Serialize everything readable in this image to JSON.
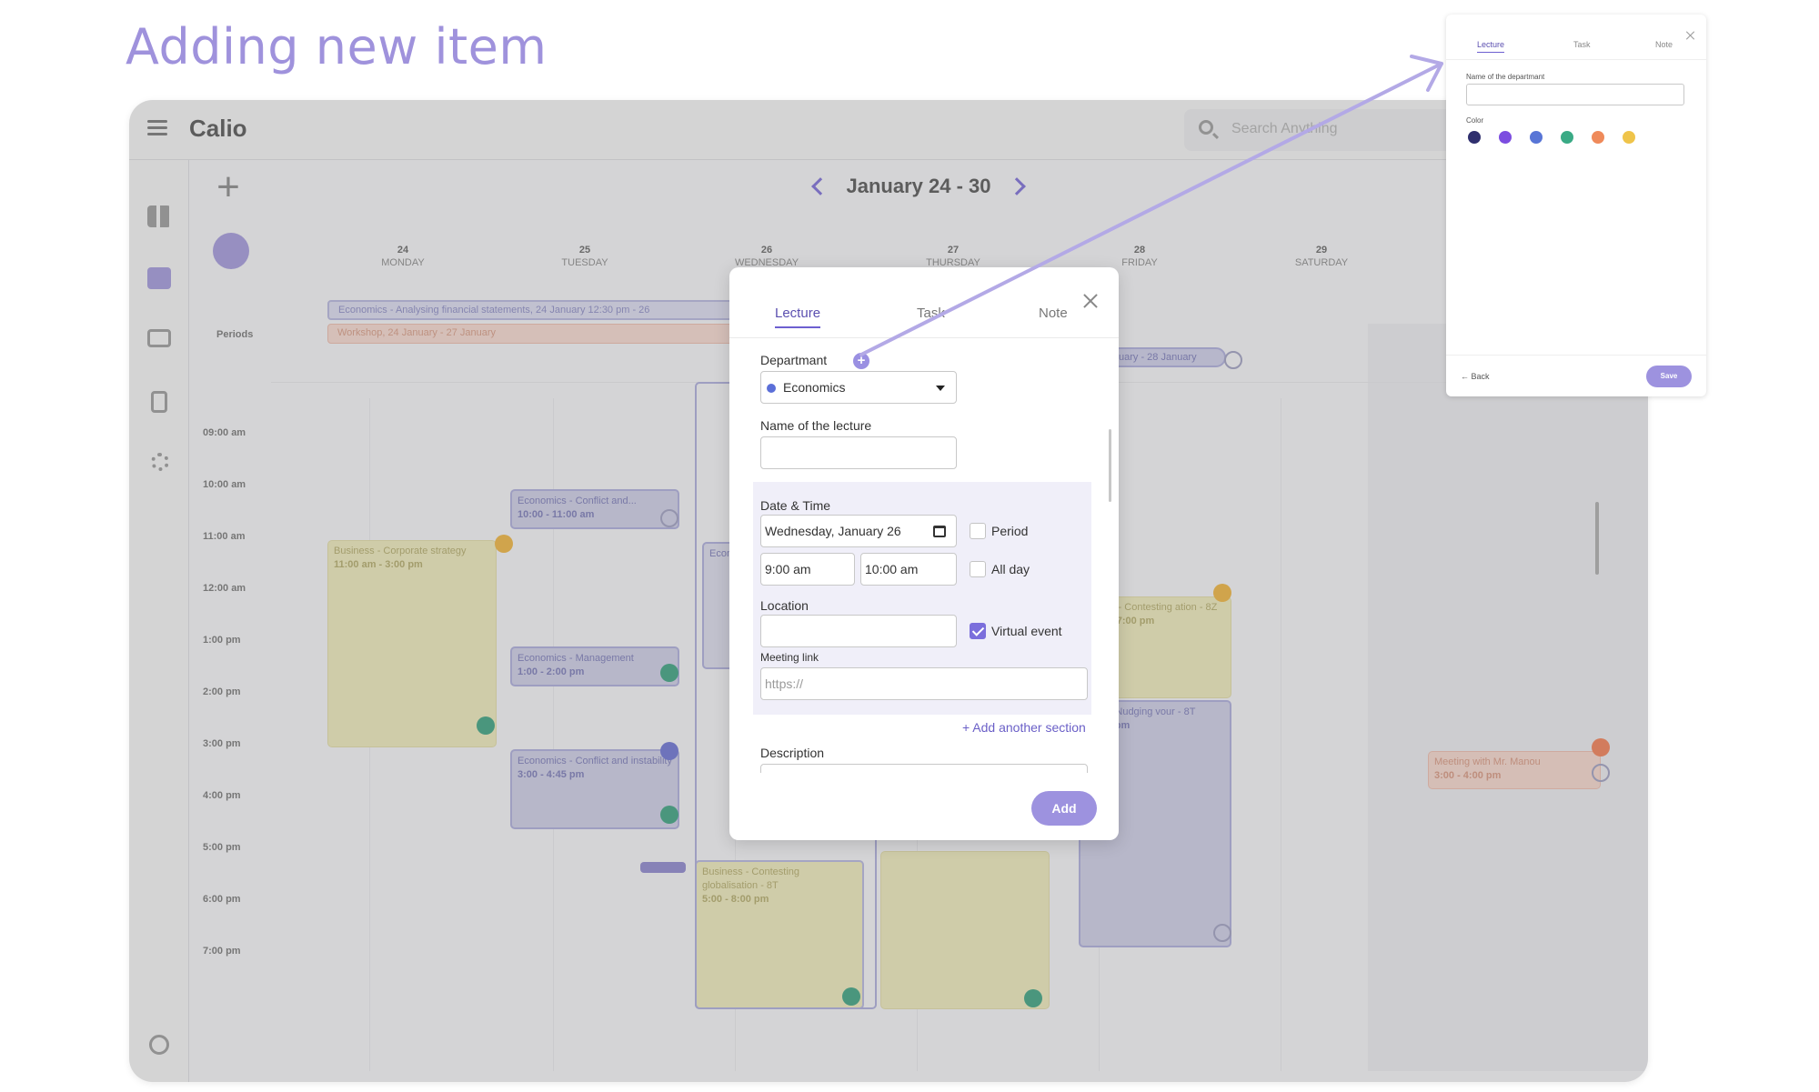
{
  "heading": "Adding new item",
  "app": {
    "brand": "Calio",
    "search_placeholder": "Search Anything",
    "week_range": "January 24 - 30",
    "days": [
      {
        "num": "24",
        "name": "MONDAY"
      },
      {
        "num": "25",
        "name": "TUESDAY"
      },
      {
        "num": "26",
        "name": "WEDNESDAY"
      },
      {
        "num": "27",
        "name": "THURSDAY"
      },
      {
        "num": "28",
        "name": "FRIDAY"
      },
      {
        "num": "29",
        "name": "SATURDAY"
      }
    ],
    "periods_label": "Periods",
    "hours": [
      "09:00 am",
      "10:00 am",
      "11:00 am",
      "12:00 am",
      "1:00 pm",
      "2:00 pm",
      "3:00 pm",
      "4:00 pm",
      "5:00 pm",
      "6:00 pm",
      "7:00 pm"
    ],
    "period_bars": [
      {
        "text": "Economics - Analysing financial statements,  24 January 12:30 pm - 26"
      },
      {
        "text": "Workshop,  24 January - 27 January"
      },
      {
        "text": "uary - 28 January"
      }
    ],
    "events": [
      {
        "title": "Economics - Conflict and...",
        "time": "10:00 - 11:00 am"
      },
      {
        "title": "Business - Corporate strategy",
        "time": "11:00 am - 3:00 pm"
      },
      {
        "title": "Economics - Management",
        "time": "1:00 - 2:00 pm"
      },
      {
        "title": "Economics - Conflict and instability",
        "time": "3:00 - 4:45 pm"
      },
      {
        "title": "Business - Contesting globalisation - 8T",
        "time": "5:00 - 8:00 pm"
      },
      {
        "title": "s - Contesting ation - 8Z",
        "time": "- 7:00 pm"
      },
      {
        "title": "mics - Nudging vour - 8T",
        "time": "- 7:00 pm"
      },
      {
        "title": "Meeting with Mr. Manou",
        "time": "3:00 - 4:00 pm"
      },
      {
        "title": "Econ",
        "time": ""
      }
    ]
  },
  "modal": {
    "tabs": [
      "Lecture",
      "Task",
      "Note"
    ],
    "department_label": "Departmant",
    "department_value": "Economics",
    "lecture_name_label": "Name of the lecture",
    "date_time_label": "Date & Time",
    "date_value": "Wednesday, January 26",
    "period_label": "Period",
    "start_time": "9:00 am",
    "end_time": "10:00 am",
    "all_day_label": "All day",
    "location_label": "Location",
    "virtual_event_label": "Virtual event",
    "meeting_link_label": "Meeting link",
    "meeting_link_placeholder": "https://",
    "add_section": "+ Add another section",
    "description_label": "Description",
    "add_button": "Add"
  },
  "mini": {
    "tabs": [
      "Lecture",
      "Task",
      "Note"
    ],
    "name_label": "Name of the departmant",
    "color_label": "Color",
    "colors": [
      "#2f2f6e",
      "#7c4de0",
      "#5875d6",
      "#3aaa85",
      "#ef8a5a",
      "#efc44a"
    ],
    "back": "Back",
    "save": "Save"
  },
  "colors": {
    "accent": "#7b6edc",
    "heading": "#9f92dc"
  }
}
